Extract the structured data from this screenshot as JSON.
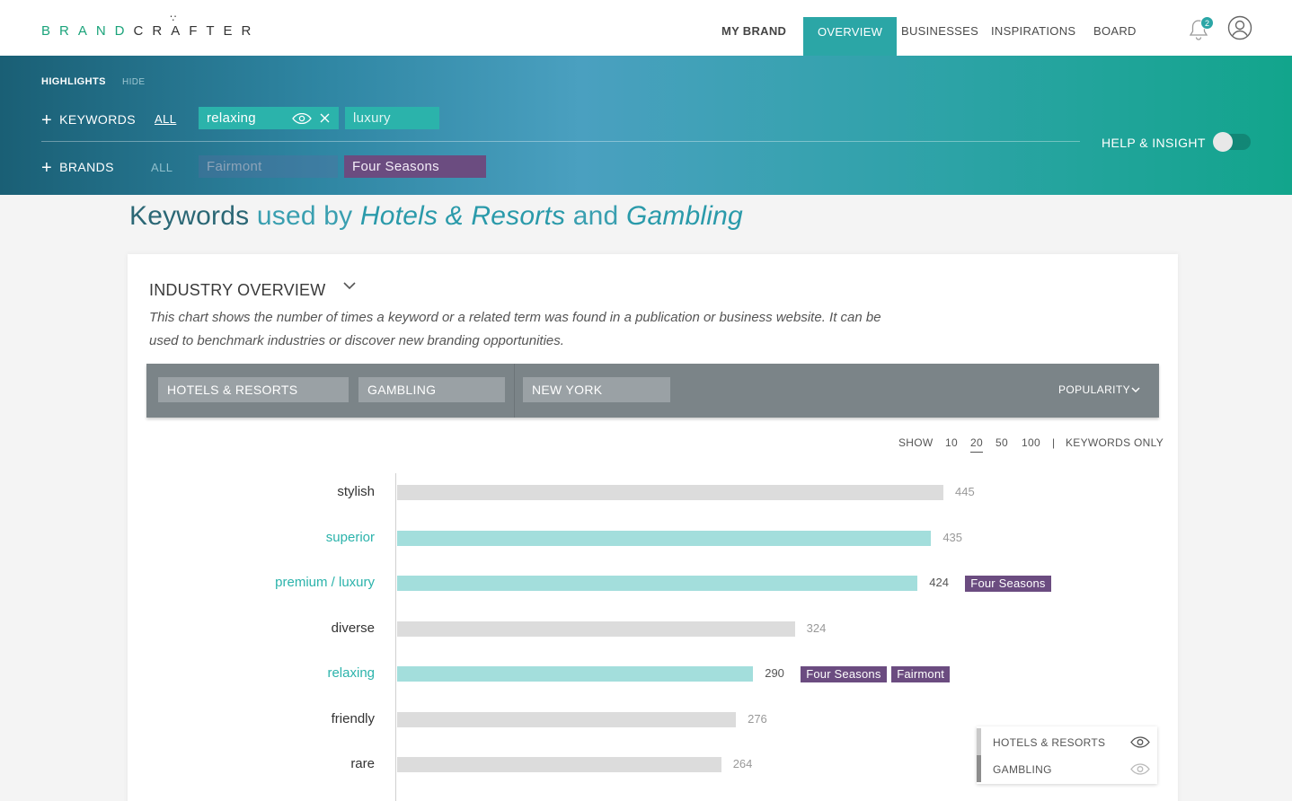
{
  "brand": {
    "logo": "BRANDCRAFTER"
  },
  "nav": {
    "items": [
      "MY BRAND",
      "OVERVIEW",
      "BUSINESSES",
      "INSPIRATIONS",
      "BOARD"
    ],
    "active": "OVERVIEW",
    "notification_count": "2"
  },
  "highlights": {
    "title": "HIGHLIGHTS",
    "hide": "HIDE",
    "keywords_label": "KEYWORDS",
    "keywords_all": "ALL",
    "keywords": [
      "relaxing",
      "luxury"
    ],
    "brands_label": "BRANDS",
    "brands_all": "ALL",
    "brands": [
      "Fairmont",
      "Four Seasons"
    ],
    "help_label": "HELP & INSIGHT",
    "help_enabled": false
  },
  "heading": {
    "part1": "Keywords",
    "part2": "used by",
    "industry1": "Hotels & Resorts",
    "and": "and",
    "industry2": "Gambling"
  },
  "card": {
    "title": "INDUSTRY OVERVIEW",
    "description": "This chart shows the number of times a keyword or a related term was found in a publication or business website. It can be used to benchmark industries or discover new branding opportunities.",
    "filters": [
      "HOTELS & RESORTS",
      "GAMBLING",
      "NEW YORK"
    ],
    "sort": "POPULARITY",
    "show_label": "SHOW",
    "show_options": [
      "10",
      "20",
      "50",
      "100"
    ],
    "show_selected": "20",
    "sep": "|",
    "keywords_only": "KEYWORDS ONLY",
    "legend": [
      "HOTELS & RESORTS",
      "GAMBLING"
    ]
  },
  "chart_data": {
    "type": "bar",
    "orientation": "horizontal",
    "categories": [
      "stylish",
      "superior",
      "premium / luxury",
      "diverse",
      "relaxing",
      "friendly",
      "rare"
    ],
    "values": [
      445,
      435,
      424,
      324,
      290,
      276,
      264
    ],
    "highlighted": [
      false,
      true,
      true,
      false,
      true,
      false,
      false
    ],
    "brand_tags": [
      [],
      [],
      [
        "Four Seasons"
      ],
      [],
      [
        "Four Seasons",
        "Fairmont"
      ],
      [],
      []
    ],
    "colors": {
      "default": "#dcdcdc",
      "highlight": "#a3dedc",
      "brand_tag": "#6b4c80"
    }
  }
}
